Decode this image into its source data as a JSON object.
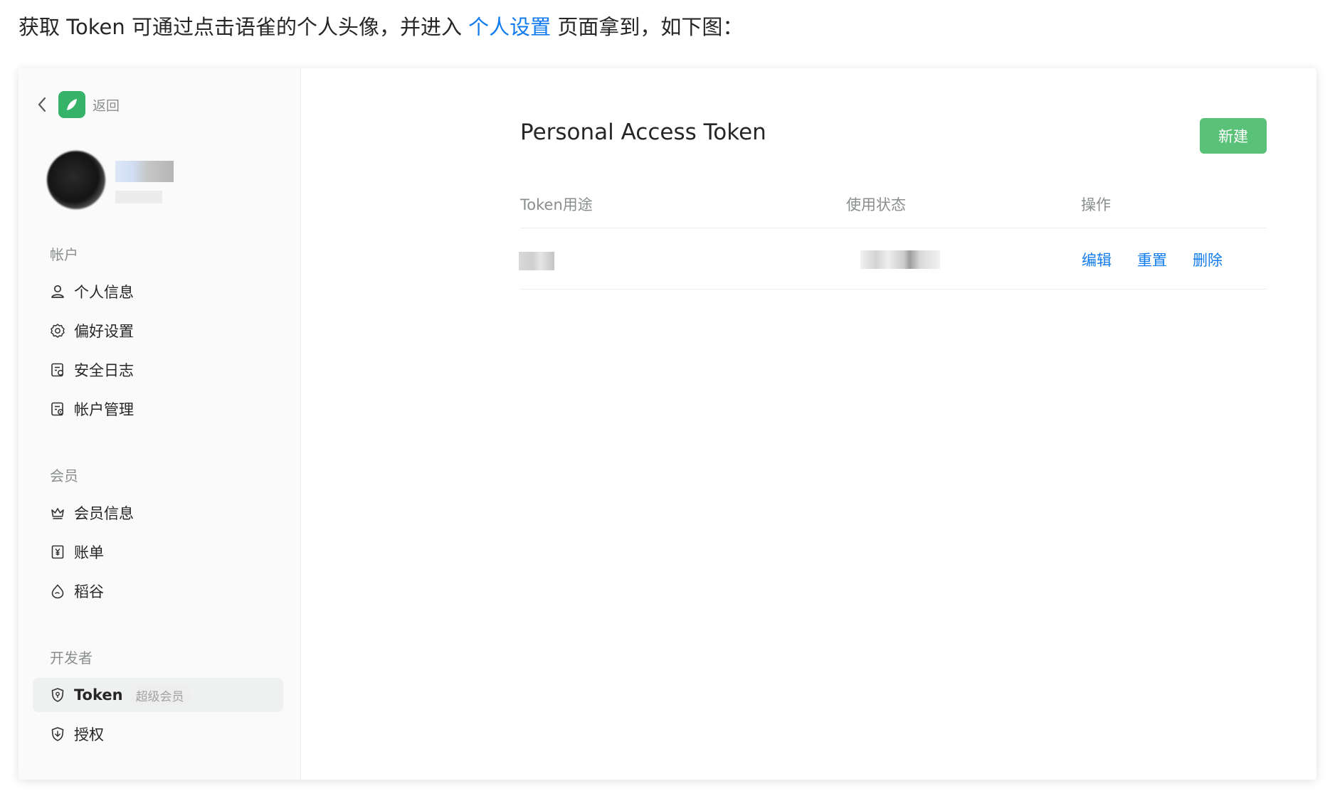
{
  "intro": {
    "before": "获取 Token 可通过点击语雀的个人头像，并进入 ",
    "link": "个人设置",
    "after": " 页面拿到，如下图："
  },
  "sidebar": {
    "back_label": "返回",
    "sections": [
      {
        "title": "帐户",
        "items": [
          {
            "label": "个人信息",
            "icon": "user-icon"
          },
          {
            "label": "偏好设置",
            "icon": "gear-icon"
          },
          {
            "label": "安全日志",
            "icon": "log-icon"
          },
          {
            "label": "帐户管理",
            "icon": "account-manage-icon"
          }
        ]
      },
      {
        "title": "会员",
        "items": [
          {
            "label": "会员信息",
            "icon": "crown-icon"
          },
          {
            "label": "账单",
            "icon": "bill-icon"
          },
          {
            "label": "稻谷",
            "icon": "drop-icon"
          }
        ]
      },
      {
        "title": "开发者",
        "items": [
          {
            "label": "Token",
            "icon": "shield-icon",
            "badge": "超级会员",
            "active": true
          },
          {
            "label": "授权",
            "icon": "authorize-icon"
          }
        ]
      }
    ]
  },
  "main": {
    "title": "Personal Access Token",
    "new_button": "新建",
    "columns": [
      "Token用途",
      "使用状态",
      "操作"
    ],
    "actions": [
      "编辑",
      "重置",
      "删除"
    ]
  },
  "colors": {
    "accent": "#5ac178",
    "link": "#117cee"
  }
}
